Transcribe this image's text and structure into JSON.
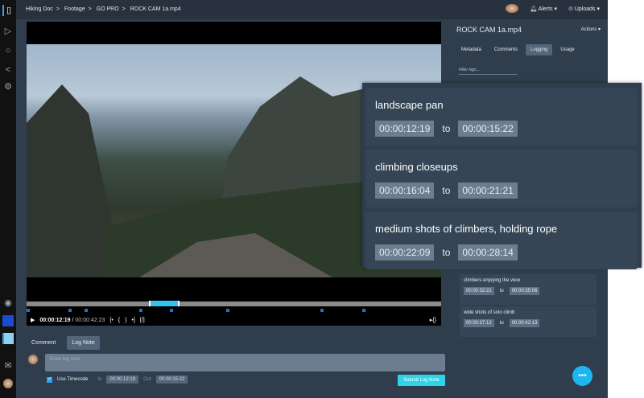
{
  "breadcrumb": [
    "Hiking Doc",
    ">",
    "Footage",
    ">",
    "GO PRO",
    ">",
    "ROCK CAM 1a.mp4"
  ],
  "header": {
    "alerts": "Alerts ▾",
    "uploads": "Uploads ▾"
  },
  "player": {
    "current_time": "00:00:12:19",
    "separator": "/",
    "duration": "00:00:42:23",
    "buttons": [
      "[•",
      "{",
      "}",
      "•]",
      "[/]"
    ],
    "right_btn": "▸{}"
  },
  "compose": {
    "tab_comment": "Comment",
    "tab_lognote": "Log Note",
    "placeholder": "Enter log note",
    "use_timecode": "Use Timecode",
    "in_label": "In",
    "in_value": "00:00:12:19",
    "out_label": "Out",
    "out_value": "00:00:15:22",
    "submit": "Submit Log Note"
  },
  "right_panel": {
    "title": "ROCK CAM 1a.mp4",
    "actions": "Actions ▾",
    "tabs": [
      "Metadata",
      "Comments",
      "Logging",
      "Usage"
    ],
    "active_tab": "Logging",
    "filter_placeholder": "Filter logs...",
    "logs": [
      {
        "desc": "climbers enjoying the view",
        "in": "00:00:32:21",
        "out": "00:00:35:06"
      },
      {
        "desc": "wide shots of solo climb",
        "in": "00:00:37:12",
        "out": "00:00:42:13"
      }
    ]
  },
  "overlay_logs": [
    {
      "desc": "landscape pan",
      "in": "00:00:12:19",
      "out": "00:00:15:22"
    },
    {
      "desc": "climbing closeups",
      "in": "00:00:16:04",
      "out": "00:00:21:21"
    },
    {
      "desc": "medium shots of climbers, holding rope",
      "in": "00:00:22:09",
      "out": "00:00:28:14"
    }
  ],
  "to_label": "to",
  "colors": {
    "accent": "#2ed3ea",
    "bg": "#2f3d4c"
  }
}
